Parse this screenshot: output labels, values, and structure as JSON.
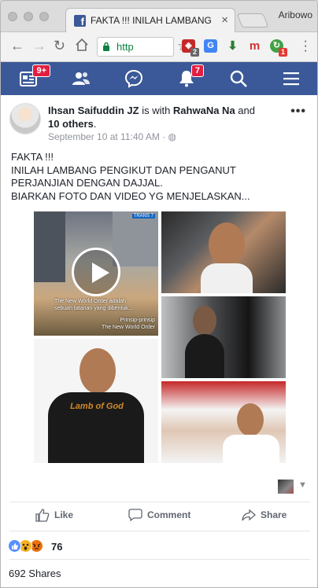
{
  "browser": {
    "tab_title": "FAKTA !!! INILAH LAMBANG P",
    "tab_close": "×",
    "profile_name": "Aribowo",
    "url_text": "http",
    "ext_badge_1": "2",
    "ext_badge_2": "1",
    "ext_m": "m"
  },
  "fb_nav": {
    "home_badge": "9+",
    "notifications_badge": "7"
  },
  "post": {
    "author": "Ihsan Saifuddin JZ",
    "with_text": " is with ",
    "tagged": "RahwaNa Na",
    "and_text": " and",
    "others": "10 others",
    "period": ".",
    "timestamp": "September 10 at 11:40 AM",
    "dot": " · ",
    "more": "•••",
    "text_lines": [
      "FAKTA !!!",
      "INILAH LAMBANG PENGIKUT DAN PENGANUT",
      "PERJANJIAN DENGAN DAJJAL.",
      "BIARKAN FOTO DAN VIDEO YG MENJELASKAN..."
    ],
    "video_caption_1": "The New World Order adalah",
    "video_caption_2": "sebuah tatanan yang dibentuk...",
    "video_caption_3": "Prinsip-prinsip",
    "video_caption_4": "The New World Order",
    "video_channel": "TRANS 7",
    "shirt_text": "Lamb of God"
  },
  "actions": {
    "like": "Like",
    "comment": "Comment",
    "share": "Share"
  },
  "stats": {
    "reaction_count": "76",
    "shares": "692 Shares"
  },
  "colors": {
    "facebook_blue": "#3b5998",
    "badge_red": "#e41e3f",
    "like_blue": "#5890ff",
    "wow_yellow": "#f7b125",
    "angry_orange": "#e9710f"
  }
}
